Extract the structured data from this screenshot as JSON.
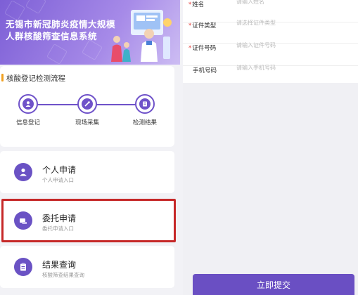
{
  "banner": {
    "title_line1": "无锡市新冠肺炎疫情大规模",
    "title_line2": "人群核酸筛查信息系统"
  },
  "flow": {
    "title": "核酸登记检测流程",
    "steps": [
      {
        "label": "信息登记",
        "icon": "user-icon"
      },
      {
        "label": "现场采集",
        "icon": "swab-icon"
      },
      {
        "label": "检测结果",
        "icon": "document-icon"
      }
    ]
  },
  "options": [
    {
      "title": "个人申请",
      "subtitle": "个人申请入口",
      "icon": "person-icon"
    },
    {
      "title": "委托申请",
      "subtitle": "委托申请入口",
      "icon": "handshake-icon"
    },
    {
      "title": "结果查询",
      "subtitle": "核酸筛查结果查询",
      "icon": "clipboard-icon"
    }
  ],
  "form": {
    "fields": [
      {
        "label": "姓名",
        "required": true,
        "placeholder": "请输入姓名"
      },
      {
        "label": "证件类型",
        "required": true,
        "placeholder": "请选择证件类型"
      },
      {
        "label": "证件号码",
        "required": true,
        "placeholder": "请输入证件号码"
      },
      {
        "label": "手机号码",
        "required": false,
        "placeholder": "请输入手机号码"
      }
    ],
    "required_mark": "*",
    "submit_label": "立即提交"
  },
  "colors": {
    "brand": "#6a4fc3",
    "highlight": "#c62828",
    "required": "#e53935"
  }
}
